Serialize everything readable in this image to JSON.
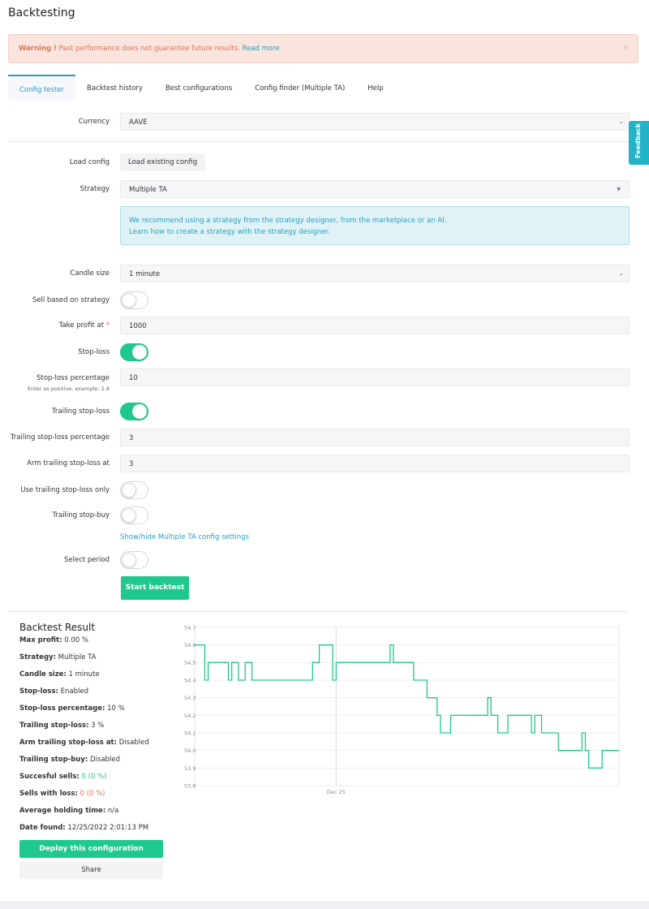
{
  "page": {
    "title": "Backtesting"
  },
  "warning": {
    "bold": "Warning !",
    "text": " Past performance does not guarantee future results.",
    "link": "Read more",
    "close": "×"
  },
  "tabs": [
    {
      "label": "Config tester"
    },
    {
      "label": "Backtest history"
    },
    {
      "label": "Best configurations"
    },
    {
      "label": "Config finder (Multiple TA)"
    },
    {
      "label": "Help"
    }
  ],
  "form": {
    "currency_label": "Currency",
    "currency_value": "AAVE",
    "load_config_label": "Load config",
    "load_config_button": "Load existing config",
    "strategy_label": "Strategy",
    "strategy_value": "Multiple TA",
    "info_line1": "We recommend using a strategy from the strategy designer, from the marketplace or an AI.",
    "info_line2": "Learn how to create a strategy with the strategy designer.",
    "candle_label": "Candle size",
    "candle_value": "1 minute",
    "sell_strategy_label": "Sell based on strategy",
    "take_profit_label": "Take profit at",
    "take_profit_req": "*",
    "take_profit_value": "1000",
    "stoploss_label": "Stop-loss",
    "stoploss_pct_label": "Stop-loss percentage",
    "stoploss_pct_sub": "Enter as positive, example: 2.8",
    "stoploss_pct_value": "10",
    "trailing_label": "Trailing stop-loss",
    "trailing_pct_label": "Trailing stop-loss percentage",
    "trailing_pct_value": "3",
    "arm_label": "Arm trailing stop-loss at",
    "arm_value": "3",
    "use_trailing_only_label": "Use trailing stop-loss only",
    "trailing_buy_label": "Trailing stop-buy",
    "toggle_ta_link": "Show/hide Multiple TA config settings",
    "select_period_label": "Select period",
    "start_button": "Start backtest",
    "toggles": {
      "sell_strategy": false,
      "stoploss": true,
      "trailing": true,
      "use_trailing_only": false,
      "trailing_buy": false,
      "select_period": false
    }
  },
  "result": {
    "title": "Backtest Result",
    "rows": [
      {
        "label": "Max profit:",
        "value": " 0.00 %"
      },
      {
        "label": "Strategy:",
        "value": " Multiple TA"
      },
      {
        "label": "Candle size:",
        "value": " 1 minute"
      },
      {
        "label": "Stop-loss:",
        "value": " Enabled"
      },
      {
        "label": "Stop-loss percentage:",
        "value": " 10 %"
      },
      {
        "label": "Trailing stop-loss:",
        "value": " 3 %"
      },
      {
        "label": "Arm trailing stop-loss at:",
        "value": " Disabled"
      },
      {
        "label": "Trailing stop-buy:",
        "value": " Disabled"
      },
      {
        "label": "Succesful sells:",
        "value": " 0 (0 %)"
      },
      {
        "label": "Sells with loss:",
        "value": " 0 (0 %)"
      },
      {
        "label": "Average holding time:",
        "value": " n/a"
      },
      {
        "label": "Date found:",
        "value": " 12/25/2022 2:01:13 PM"
      }
    ],
    "deploy_button": "Deploy this configuration",
    "share_button": "Share"
  },
  "feedback": "Feedback",
  "colors": {
    "accent": "#1fc98e",
    "link": "#2a9dc0",
    "line": "#1fc98e"
  },
  "chart_data": {
    "type": "line",
    "ylim": [
      53.8,
      54.7
    ],
    "yticks": [
      "54.7",
      "54.6",
      "54.5",
      "54.4",
      "54.3",
      "54.2",
      "54.1",
      "54.0",
      "53.9",
      "53.8"
    ],
    "xtick_label": "Dec 25",
    "xtick_index": 42,
    "series": [
      {
        "values": [
          54.6,
          54.6,
          54.6,
          54.4,
          54.5,
          54.5,
          54.5,
          54.5,
          54.5,
          54.5,
          54.4,
          54.5,
          54.5,
          54.4,
          54.4,
          54.5,
          54.5,
          54.4,
          54.4,
          54.4,
          54.4,
          54.4,
          54.4,
          54.4,
          54.4,
          54.4,
          54.4,
          54.4,
          54.4,
          54.4,
          54.4,
          54.4,
          54.4,
          54.4,
          54.4,
          54.5,
          54.5,
          54.6,
          54.6,
          54.6,
          54.6,
          54.4,
          54.5,
          54.5,
          54.5,
          54.5,
          54.5,
          54.5,
          54.5,
          54.5,
          54.5,
          54.5,
          54.5,
          54.5,
          54.5,
          54.5,
          54.5,
          54.5,
          54.6,
          54.5,
          54.5,
          54.5,
          54.5,
          54.5,
          54.5,
          54.4,
          54.4,
          54.4,
          54.4,
          54.3,
          54.3,
          54.3,
          54.2,
          54.1,
          54.1,
          54.1,
          54.2,
          54.2,
          54.2,
          54.2,
          54.2,
          54.2,
          54.2,
          54.2,
          54.2,
          54.2,
          54.2,
          54.3,
          54.2,
          54.2,
          54.1,
          54.1,
          54.1,
          54.2,
          54.2,
          54.2,
          54.2,
          54.2,
          54.2,
          54.2,
          54.1,
          54.2,
          54.2,
          54.1,
          54.1,
          54.1,
          54.1,
          54.1,
          54.0,
          54.0,
          54.0,
          54.0,
          54.0,
          54.0,
          54.0,
          54.1,
          54.0,
          53.9,
          53.9,
          53.9,
          53.9,
          54.0,
          54.0,
          54.0,
          54.0,
          54.0,
          54.0
        ]
      }
    ]
  }
}
